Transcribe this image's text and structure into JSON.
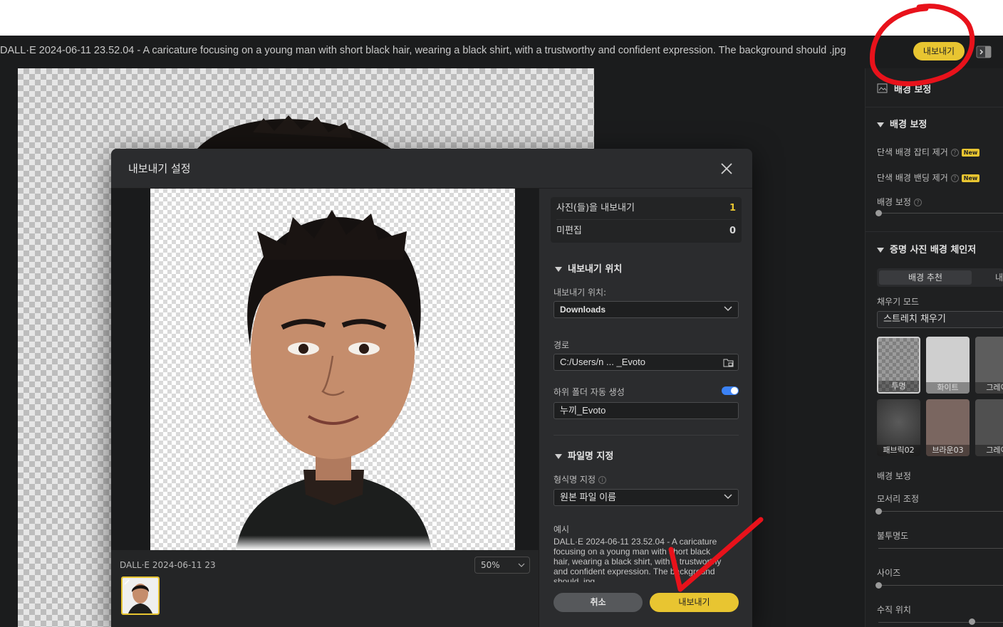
{
  "topbar": {
    "file_title": "DALL·E 2024-06-11 23.52.04 - A caricature focusing on a young man with short black hair, wearing a black shirt, with a trustworthy and confident expression. The background should .jpg",
    "export_label": "내보내기"
  },
  "sidebar": {
    "section_title": "배경 보정",
    "group1_title": "배경 보정",
    "item_noise": "단색 배경 잡티 제거",
    "item_banding": "단색 배경 밴딩 제거",
    "new_badge": "New",
    "item_bg_correct": "배경 보정",
    "group2_title": "증명 사진 배경 체인저",
    "tab_recommend": "배경 추천",
    "tab_partial": "내",
    "fill_mode_label": "채우기 모드",
    "fill_mode_value": "스트레치 채우기",
    "thumbs": [
      "투명",
      "화이트",
      "그레이",
      "패브릭02",
      "브라운03",
      "그레이"
    ],
    "bg_correct_label": "배경 보정",
    "edge_label": "모서리 조정",
    "opacity_label": "불투명도",
    "size_label": "사이즈",
    "vertical_label": "수직 위치"
  },
  "modal": {
    "title": "내보내기 설정",
    "preview_filename": "DALL·E 2024-06-11 23",
    "zoom": "50%",
    "stats": {
      "export_label": "사진(들)을 내보내기",
      "export_count": "1",
      "unedited_label": "미편집",
      "unedited_count": "0"
    },
    "location": {
      "section": "내보내기 위치",
      "label": "내보내기 위치:",
      "value": "Downloads",
      "path_label": "경로",
      "path_value": "C:/Users/n ... _Evoto",
      "subfolder_label": "하위 폴더 자동 생성",
      "subfolder_value": "누끼_Evoto",
      "subfolder_enabled": true
    },
    "filename": {
      "section": "파일명 지정",
      "format_label": "형식명 지정",
      "format_value": "원본 파일 이름",
      "example_label": "예시",
      "example_text": "DALL·E 2024-06-11 23.52.04 - A caricature focusing on a young man with short black hair, wearing a black shirt, with a trustworthy and confident expression. The background should .jpg"
    },
    "cancel_label": "취소",
    "export_label": "내보내기"
  },
  "colors": {
    "accent": "#e8c531",
    "annotation": "#e8121b",
    "toggle_on": "#3b82f6"
  }
}
